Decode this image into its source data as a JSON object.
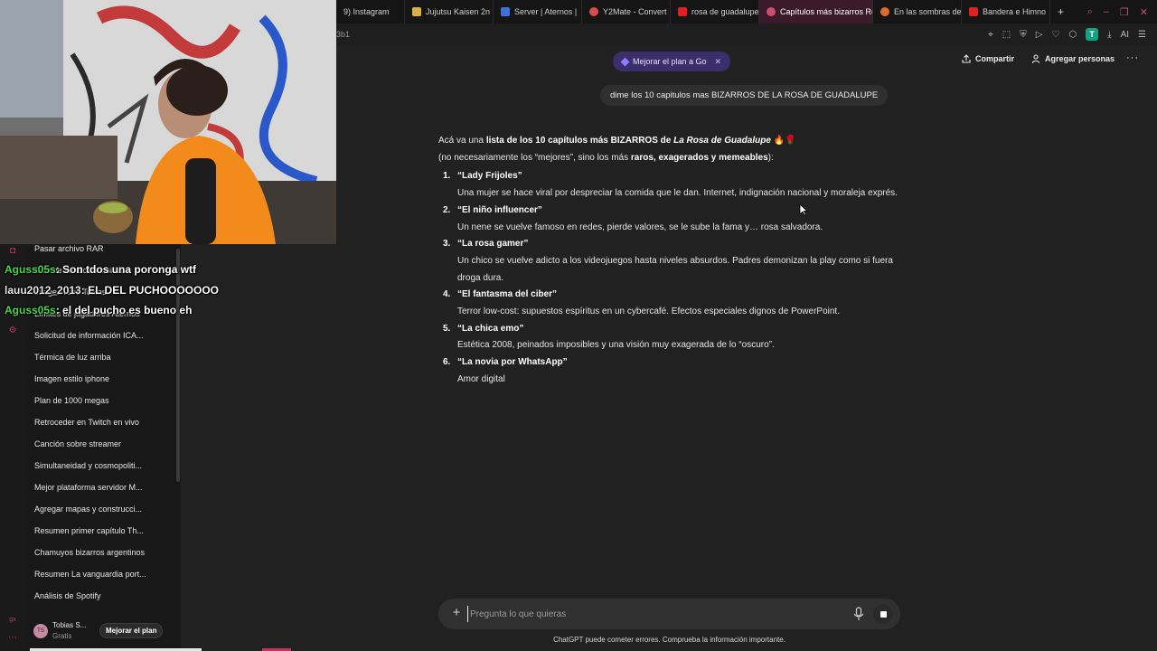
{
  "browser": {
    "tabs": [
      {
        "label": "9) Instagram",
        "color": "#151515"
      },
      {
        "label": "Jujutsu Kaisen 2n",
        "color": "#d6b04a"
      },
      {
        "label": "Server | Aternos |",
        "color": "#3f6fd8"
      },
      {
        "label": "Y2Mate - Convert",
        "color": "#d94a4a"
      },
      {
        "label": "rosa de guadalupe",
        "color": "#e02020"
      },
      {
        "label": "Capítulos más bizarros Ro",
        "color": "#cc4c6e"
      },
      {
        "label": "En las sombras de",
        "color": "#e06a2c"
      },
      {
        "label": "Bandera e Himno",
        "color": "#e02020"
      }
    ],
    "address_fragment": "3b1",
    "new_tab_label": "+",
    "ai_label": "AI",
    "t_badge": "T"
  },
  "sidebar": {
    "items": [
      "Pasar archivo RAR",
      "Salir de Windows Insider",
      "Imagen retro Tobias",
      "Límites de jugadores Aternos",
      "Solicitud de información ICA...",
      "Térmica de luz arriba",
      "Imagen estilo iphone",
      "Plan de 1000 megas",
      "Retroceder en Twitch en vivo",
      "Canción sobre streamer",
      "Simultaneidad y cosmopoliti...",
      "Mejor plataforma servidor M...",
      "Agregar mapas y construcci...",
      "Resumen primer capítulo Th...",
      "Chamuyos bizarros argentinos",
      "Resumen La vanguardia port...",
      "Análisis de Spotify"
    ],
    "user": {
      "initials": "TS",
      "name": "Tobias S...",
      "plan": "Gratis",
      "upgrade_label": "Mejorar el plan"
    }
  },
  "stream_chat": [
    {
      "user": "Aguss05s",
      "sep": ": ",
      "msg": "Son tdos una poronga wtf",
      "color": "green"
    },
    {
      "user": "lauu2012_2013",
      "sep": ": ",
      "msg": "EL DEL PUCHOOOOOOO",
      "color": "white"
    },
    {
      "user": "Aguss05s",
      "sep": ": ",
      "msg": "el del pucho es bueno eh",
      "color": "green"
    }
  ],
  "header": {
    "upgrade_pill": "Mejorar el plan a Go",
    "share": "Compartir",
    "add_people": "Agregar personas",
    "more": "···"
  },
  "conversation": {
    "user_message": "dime los 10 capitulos mas BIZARROS DE LA ROSA DE GUADALUPE",
    "intro_pre": "Acá va una ",
    "intro_bold": "lista de los 10 capítulos más BIZARROS de ",
    "intro_italic": "La Rosa de Guadalupe",
    "intro_emoji": " 🔥🌹",
    "intro2_pre": "(no necesariamente los “mejores”, sino los más ",
    "intro2_bold": "raros, exagerados y memeables",
    "intro2_post": "):",
    "items": [
      {
        "num": "1.",
        "title": "“Lady Frijoles”",
        "desc": "Una mujer se hace viral por despreciar la comida que le dan. Internet, indignación nacional y moraleja exprés."
      },
      {
        "num": "2.",
        "title": "“El niño influencer”",
        "desc": "Un nene se vuelve famoso en redes, pierde valores, se le sube la fama y… rosa salvadora."
      },
      {
        "num": "3.",
        "title": "“La rosa gamer”",
        "desc": "Un chico se vuelve adicto a los videojuegos hasta niveles absurdos. Padres demonizan la play como si fuera droga dura."
      },
      {
        "num": "4.",
        "title": "“El fantasma del ciber”",
        "desc": "Terror low-cost: supuestos espíritus en un cybercafé. Efectos especiales dignos de PowerPoint."
      },
      {
        "num": "5.",
        "title": "“La chica emo”",
        "desc": "Estética 2008, peinados imposibles y una visión muy exagerada de lo “oscuro”."
      },
      {
        "num": "6.",
        "title": "“La novia por WhatsApp”",
        "desc": "Amor digital"
      }
    ]
  },
  "composer": {
    "plus": "+",
    "placeholder": "Pregunta lo que quieras",
    "value": ""
  },
  "footer": {
    "disclaimer": "ChatGPT puede cometer errores. Comprueba la información importante."
  },
  "colors": {
    "background": "#212121",
    "sidebar": "#181818",
    "accent_purple": "#3a2f6b",
    "chat_green": "#4bd651",
    "opera_red": "#c0335a"
  }
}
